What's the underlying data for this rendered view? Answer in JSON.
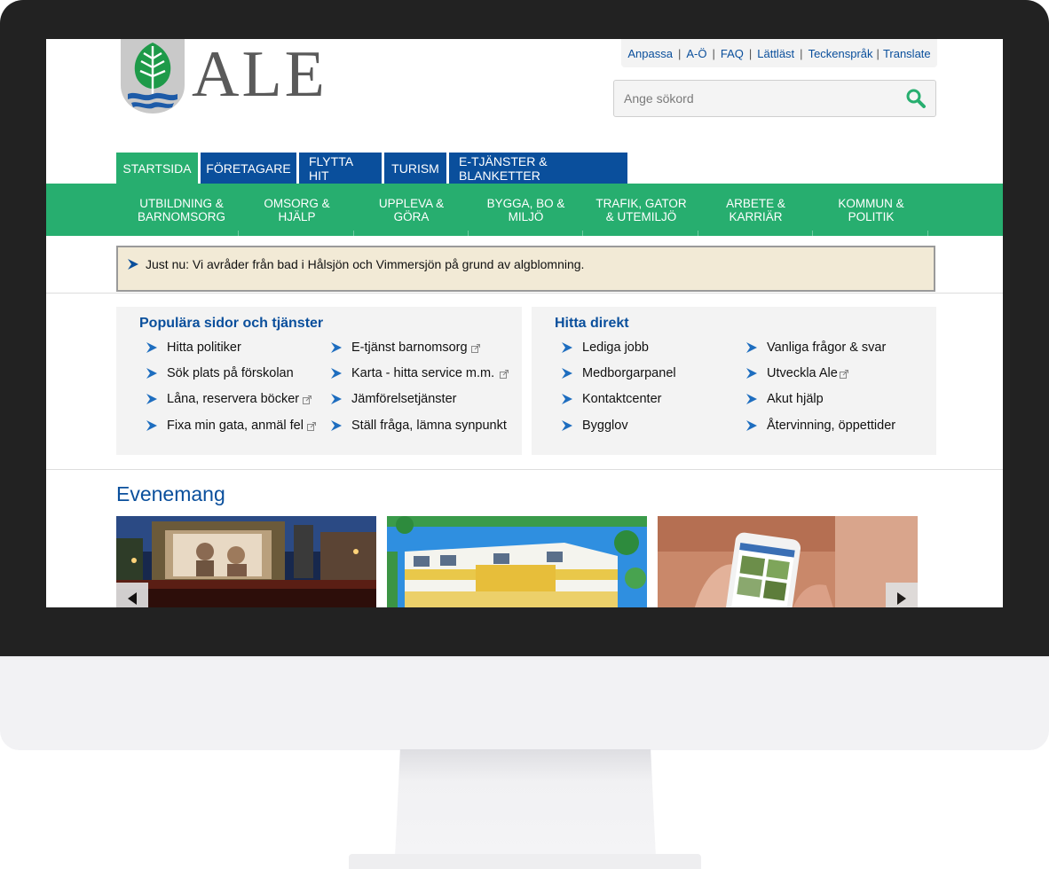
{
  "site": {
    "logo_text": "ALE"
  },
  "toplinks": [
    "Anpassa",
    "A-Ö",
    "FAQ",
    "Lättläst",
    "Teckenspråk",
    "Translate"
  ],
  "search": {
    "placeholder": "Ange sökord"
  },
  "tabs": [
    {
      "label": "STARTSIDA",
      "active": true
    },
    {
      "label": "FÖRETAGARE",
      "active": false
    },
    {
      "label": "FLYTTA HIT",
      "active": false
    },
    {
      "label": "TURISM",
      "active": false
    },
    {
      "label": "E-TJÄNSTER & BLANKETTER",
      "active": false
    }
  ],
  "mainnav": [
    {
      "line1": "UTBILDNING &",
      "line2": "BARNOMSORG"
    },
    {
      "line1": "OMSORG &",
      "line2": "HJÄLP"
    },
    {
      "line1": "UPPLEVA &",
      "line2": "GÖRA"
    },
    {
      "line1": "BYGGA, BO &",
      "line2": "MILJÖ"
    },
    {
      "line1": "TRAFIK, GATOR",
      "line2": "& UTEMILJÖ"
    },
    {
      "line1": "ARBETE &",
      "line2": "KARRIÄR"
    },
    {
      "line1": "KOMMUN &",
      "line2": "POLITIK"
    }
  ],
  "notice": {
    "text": "Just nu: Vi avråder från bad i Hålsjön och Vimmersjön på grund av algblomning."
  },
  "popular": {
    "title": "Populära sidor och tjänster",
    "col1": [
      {
        "label": "Hitta politiker",
        "external": false
      },
      {
        "label": "Sök plats på förskolan",
        "external": false
      },
      {
        "label": "Låna, reservera böcker",
        "external": true
      },
      {
        "label": "Fixa min gata, anmäl fel",
        "external": true
      }
    ],
    "col2": [
      {
        "label": "E-tjänst barnomsorg",
        "external": true
      },
      {
        "label": "Karta - hitta service m.m.",
        "external": true
      },
      {
        "label": "Jämförelsetjänster",
        "external": false
      },
      {
        "label": "Ställ fråga, lämna synpunkt",
        "external": false
      }
    ]
  },
  "direct": {
    "title": "Hitta direkt",
    "col1": [
      {
        "label": "Lediga jobb",
        "external": false
      },
      {
        "label": "Medborgarpanel",
        "external": false
      },
      {
        "label": "Kontaktcenter",
        "external": false
      },
      {
        "label": "Bygglov",
        "external": false
      }
    ],
    "col2": [
      {
        "label": "Vanliga frågor & svar",
        "external": false
      },
      {
        "label": "Utveckla Ale",
        "external": true
      },
      {
        "label": "Akut hjälp",
        "external": false
      },
      {
        "label": "Återvinning, öppettider",
        "external": false
      }
    ]
  },
  "events": {
    "title": "Evenemang"
  },
  "colors": {
    "brand_blue": "#0a4f9c",
    "brand_green": "#27ae6f",
    "notice_bg": "#f2ead6"
  }
}
